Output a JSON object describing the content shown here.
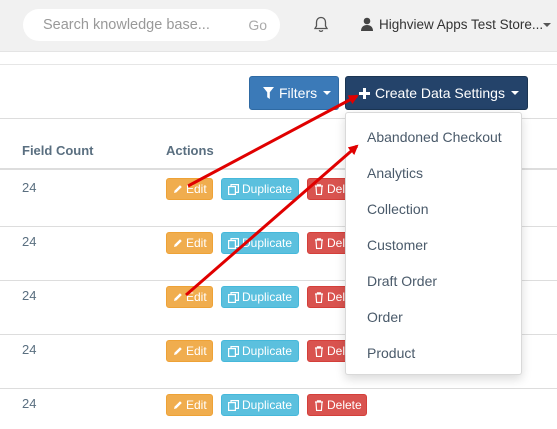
{
  "header": {
    "search_placeholder": "Search knowledge base...",
    "search_go": "Go",
    "store_name": "Highview Apps Test Store..."
  },
  "toolbar": {
    "filters_label": "Filters",
    "create_label": "Create Data Settings"
  },
  "table": {
    "columns": [
      "Field Count",
      "Actions"
    ],
    "rows": [
      {
        "field_count": "24"
      },
      {
        "field_count": "24"
      },
      {
        "field_count": "24"
      },
      {
        "field_count": "24"
      },
      {
        "field_count": "24"
      }
    ],
    "actions": {
      "edit": "Edit",
      "duplicate": "Duplicate",
      "delete": "Delete"
    }
  },
  "dropdown": {
    "items": [
      "Abandoned Checkout",
      "Analytics",
      "Collection",
      "Customer",
      "Draft Order",
      "Order",
      "Product"
    ]
  },
  "colors": {
    "filters": "#3b7ab8",
    "create": "#24436a",
    "edit": "#f0ad4e",
    "duplicate": "#5bc0de",
    "delete": "#d9534f",
    "annotation_arrow": "#e00000"
  }
}
